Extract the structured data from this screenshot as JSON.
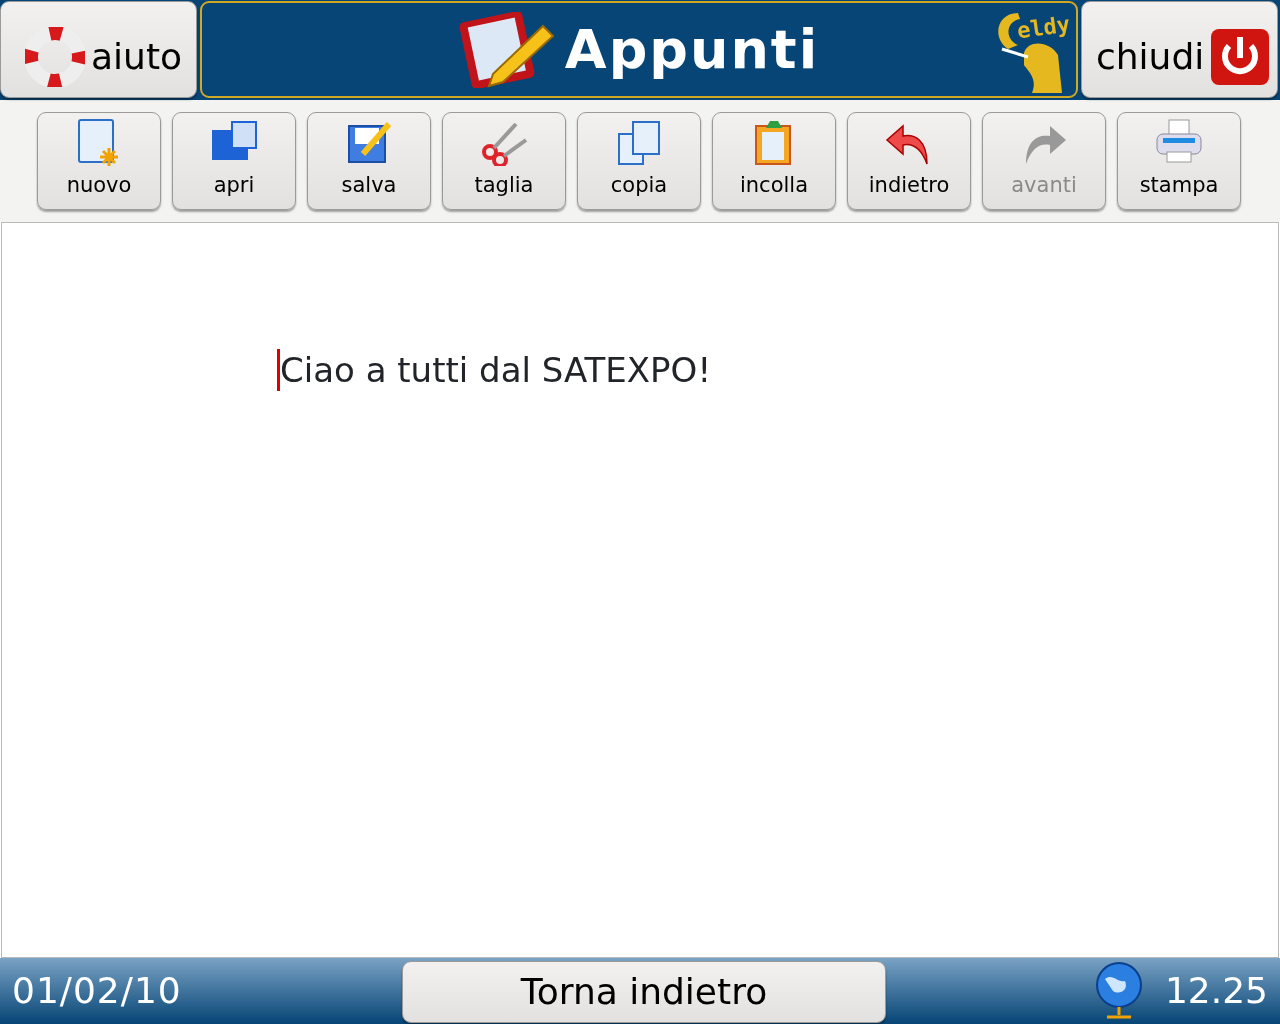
{
  "header": {
    "help_button": "aiuto",
    "title": "Appunti",
    "logo_text": "eldy",
    "close_button": "chiudi"
  },
  "toolbar": [
    {
      "kind": "new",
      "label": "nuovo",
      "disabled": false
    },
    {
      "kind": "open",
      "label": "apri",
      "disabled": false
    },
    {
      "kind": "save",
      "label": "salva",
      "disabled": false
    },
    {
      "kind": "cut",
      "label": "taglia",
      "disabled": false
    },
    {
      "kind": "copy",
      "label": "copia",
      "disabled": false
    },
    {
      "kind": "paste",
      "label": "incolla",
      "disabled": false
    },
    {
      "kind": "undo",
      "label": "indietro",
      "disabled": false
    },
    {
      "kind": "redo",
      "label": "avanti",
      "disabled": true
    },
    {
      "kind": "print",
      "label": "stampa",
      "disabled": false
    }
  ],
  "editor": {
    "text": "Ciao a tutti dal SATEXPO!"
  },
  "status_bar": {
    "date": "01/02/10",
    "back_button": "Torna indietro",
    "time": "12.25"
  }
}
